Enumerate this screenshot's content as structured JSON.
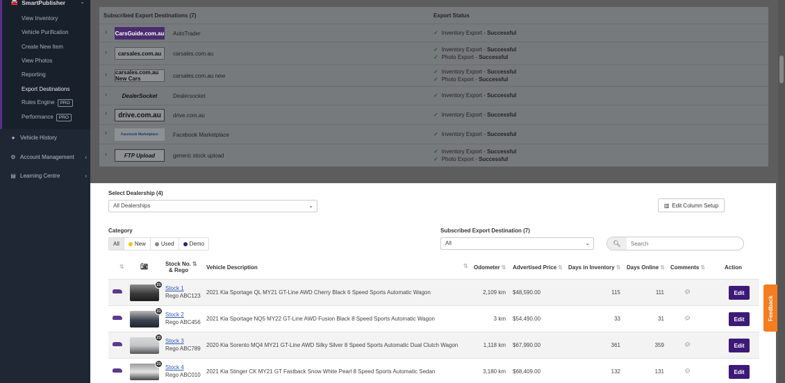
{
  "sidebar": {
    "section_title": "SmartPublisher",
    "sub_items": [
      {
        "label": "View Inventory",
        "active": false
      },
      {
        "label": "Vehicle Purification",
        "active": false
      },
      {
        "label": "Create New Item",
        "active": false
      },
      {
        "label": "View Photos",
        "active": false
      },
      {
        "label": "Reporting",
        "active": false
      },
      {
        "label": "Export Destinations",
        "active": true
      },
      {
        "label": "Rules Engine",
        "pro": "PRO"
      },
      {
        "label": "Performance",
        "pro": "PRO"
      }
    ],
    "main_items": [
      {
        "label": "Vehicle History"
      },
      {
        "label": "Account Management"
      },
      {
        "label": "Learning Centre"
      }
    ]
  },
  "export_panel": {
    "header_destinations": "Subscribed Export Destinations (7)",
    "header_status": "Export Status",
    "rows": [
      {
        "logo": "CarsGuide.com.au",
        "name": "AutoTrader",
        "statuses": [
          {
            "label": "Inventory Export - ",
            "value": "Successful"
          }
        ]
      },
      {
        "logo": "carsales.com.au",
        "name": "carsales.com.au",
        "statuses": [
          {
            "label": "Inventory Export - ",
            "value": "Successful"
          },
          {
            "label": "Photo Export - ",
            "value": "Successful"
          }
        ]
      },
      {
        "logo": "carsales.com.au New Cars",
        "name": "carsales.com.au new",
        "statuses": [
          {
            "label": "Inventory Export - ",
            "value": "Successful"
          },
          {
            "label": "Photo Export - ",
            "value": "Successful"
          }
        ]
      },
      {
        "logo": "DealerSocket",
        "name": "Dealersocket",
        "statuses": [
          {
            "label": "Inventory Export - ",
            "value": "Successful"
          }
        ]
      },
      {
        "logo": "drive.com.au",
        "name": "drive.com.au",
        "statuses": [
          {
            "label": "Inventory Export - ",
            "value": "Successful"
          }
        ]
      },
      {
        "logo": "Facebook Marketplace",
        "name": "Facebook Marketplace",
        "statuses": [
          {
            "label": "Inventory Export - ",
            "value": "Successful"
          }
        ]
      },
      {
        "logo": "FTP Upload",
        "name": "generic stock upload",
        "statuses": [
          {
            "label": "Inventory Export - ",
            "value": "Successful"
          },
          {
            "label": "Photo Export - ",
            "value": "Successful"
          }
        ]
      }
    ]
  },
  "filters": {
    "dealership_label": "Select Dealership (4)",
    "dealership_value": "All Dealerships",
    "edit_columns_label": "Edit Column Setup",
    "category_label": "Category",
    "categories": [
      {
        "label": "All",
        "color": null,
        "selected": true
      },
      {
        "label": "New",
        "color": "#f5c518",
        "selected": false
      },
      {
        "label": "Used",
        "color": "#888888",
        "selected": false
      },
      {
        "label": "Demo",
        "color": "#3d1a78",
        "selected": false
      }
    ],
    "export_dest_label": "Subscribed Export Destination (7)",
    "export_dest_value": "All",
    "search_placeholder": "Search"
  },
  "table": {
    "headers": {
      "stock": "Stock No.",
      "stock_sub": "& Rego",
      "description": "Vehicle Description",
      "odometer": "Odometer",
      "price": "Advertised Price",
      "days": "Days in Inventory",
      "online": "Days Online",
      "comments": "Comments",
      "action": "Action"
    },
    "rows": [
      {
        "photos": "21",
        "stock": "Stock 1",
        "rego": "Rego ABC123",
        "description": "2021 Kia Sportage QL MY21 GT-Line AWD Cherry Black 6 Speed Sports Automatic Wagon",
        "odometer": "2,109 km",
        "price": "$48,590.00",
        "days": "115",
        "online": "111",
        "edit": "Edit"
      },
      {
        "photos": "21",
        "stock": "Stock 2",
        "rego": "Rego ABC456",
        "description": "2021 Kia Sportage NQ5 MY22 GT-Line AWD Fusion Black 8 Speed Sports Automatic Wagon",
        "odometer": "3 km",
        "price": "$54,490.00",
        "days": "33",
        "online": "31",
        "edit": "Edit"
      },
      {
        "photos": "21",
        "stock": "Stock 3",
        "rego": "Rego ABC789",
        "description": "2020 Kia Sorento MQ4 MY21 GT-Line AWD Silky Silver 8 Speed Sports Automatic Dual Clutch Wagon",
        "odometer": "1,118 km",
        "price": "$67,990.00",
        "days": "361",
        "online": "359",
        "edit": "Edit"
      },
      {
        "photos": "21",
        "stock": "Stock 4",
        "rego": "Rego ABC010",
        "description": "2021 Kia Stinger CK MY21 GT Fastback Snow White Pearl 8 Speed Sports Automatic Sedan",
        "odometer": "3,180 km",
        "price": "$68,409.00",
        "days": "132",
        "online": "131",
        "edit": "Edit"
      }
    ]
  },
  "feedback_label": "Feedback",
  "colors": {
    "accent": "#3d1a78",
    "success": "#1d5d1d",
    "feedback": "#f57c1f"
  }
}
